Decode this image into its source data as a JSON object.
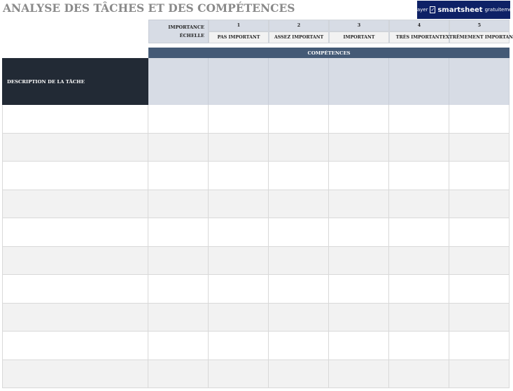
{
  "title": "ANALYSE DES TÂCHES ET DES COMPÉTENCES",
  "banner": {
    "prefix": "Essayer",
    "brand": "smartsheet",
    "suffix": "gratuitement."
  },
  "scale": {
    "label_line1": "IMPORTANCE",
    "label_line2": "ÉCHELLE",
    "levels": [
      {
        "number": "1",
        "text": "PAS IMPORTANT"
      },
      {
        "number": "2",
        "text": "ASSEZ IMPORTANT"
      },
      {
        "number": "3",
        "text": "IMPORTANT"
      },
      {
        "number": "4",
        "text": "TRÈS IMPORTANT"
      },
      {
        "number": "5",
        "text": "EXTRÊMEMENT IMPORTANT"
      }
    ]
  },
  "table": {
    "competences_header": "COMPÉTENCES",
    "description_header": "DESCRIPTION DE LA TÂCHE",
    "competence_columns": 6,
    "rows": 10,
    "colors": {
      "row_white": "#ffffff",
      "row_gray": "#f2f2f2",
      "header_dark": "#222a35",
      "header_blue": "#445a76",
      "header_light": "#d7dce5"
    }
  }
}
